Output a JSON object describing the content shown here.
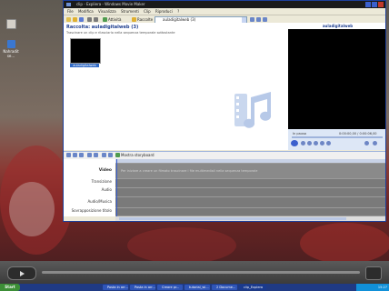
{
  "desktop": {
    "icons": [
      {
        "label": "",
        "icon": "application-icon"
      },
      {
        "label": "Nahradit se...",
        "icon": "folder-icon"
      }
    ]
  },
  "window": {
    "title": "clip - Expliera - Windows Movie Maker",
    "menu": [
      "File",
      "Modifica",
      "Visualizza",
      "Strumenti",
      "Clip",
      "Riproduci",
      "?"
    ],
    "toolbar": {
      "tasks_label": "Attività",
      "collections_label": "Raccolte",
      "collection_select": "auladigitalweb (3)"
    },
    "collection": {
      "title": "Raccolta: auladigitalweb (3)",
      "hint": "Trascinare un clip e rilasciarlo nella sequenza temporale sottostante",
      "clip_label": "auladigitalweb"
    },
    "preview": {
      "title": "auladigitalweb",
      "status": "In pausa",
      "time": "0:00:00,00 / 0:00:06,00"
    },
    "storyboard": {
      "button_label": "Mostra storyboard",
      "video_hint": "Per iniziare a creare un filmato trascinare i file multimediali nella sequenza temporale",
      "tracks": [
        "Video",
        "Transizione",
        "Audio",
        "Audio/Musica",
        "Sovrapposizione titolo"
      ]
    }
  },
  "taskbar": {
    "start_label": "Start",
    "tasks": [
      "Posta in arr...",
      "Posta in arr...",
      "Creare pr...",
      "tutorial_wi...",
      "2 Docume...",
      "clip_Explera"
    ],
    "clock": "15:27"
  },
  "colors": {
    "window_border": "#1d3f9a",
    "timeline_bg": "#7a7a7a",
    "taskbar": "#1f3a84"
  }
}
